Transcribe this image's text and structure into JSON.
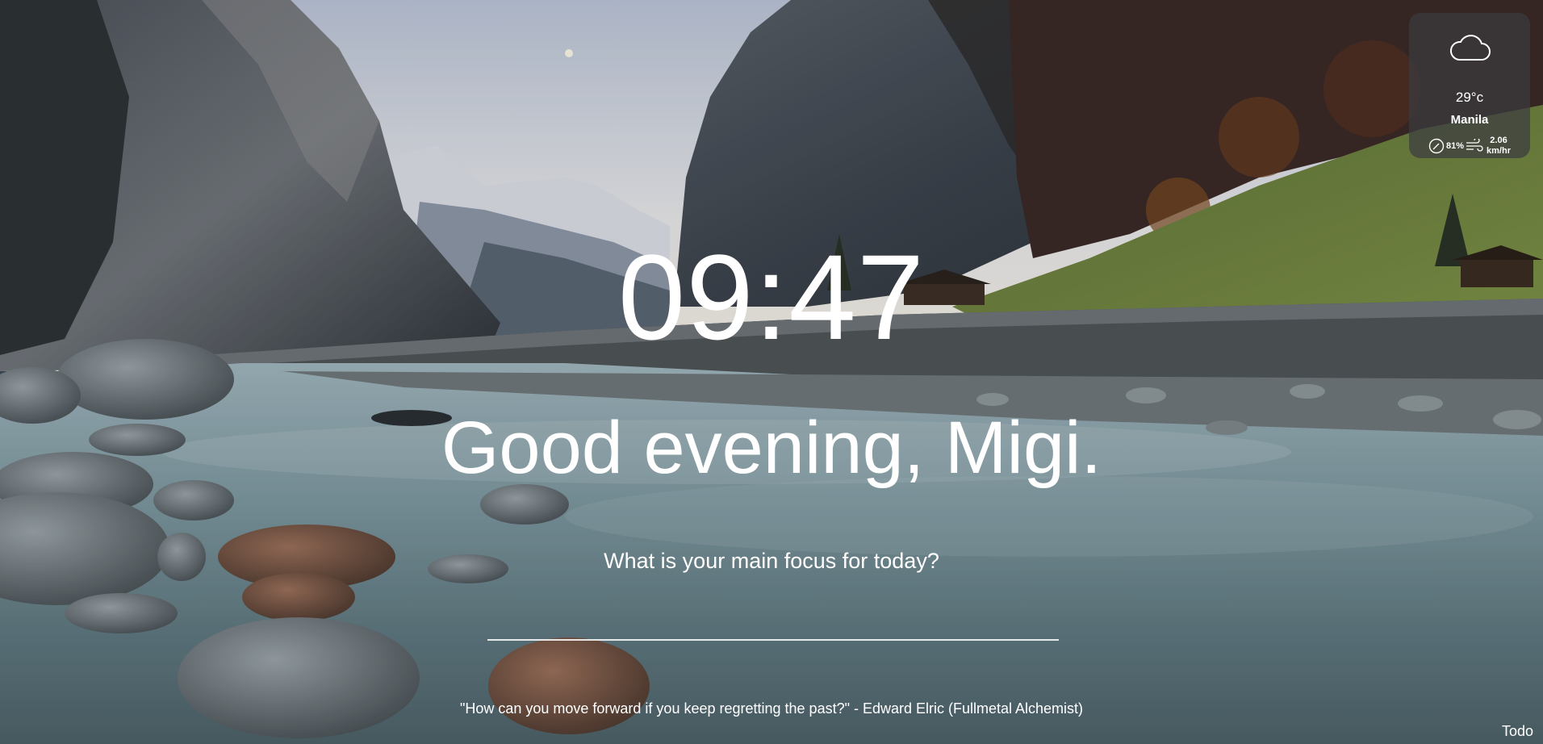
{
  "weather": {
    "icon": "cloud-icon",
    "temperature": "29°c",
    "city": "Manila",
    "humidity": "81%",
    "wind_speed": "2.06",
    "wind_unit": "km/hr"
  },
  "clock": {
    "time": "09:47"
  },
  "greeting": {
    "text": "Good evening, Migi."
  },
  "focus": {
    "question": "What is your main focus for today?",
    "value": ""
  },
  "quote": {
    "text": "\"How can you move forward if you keep regretting the past?\" - Edward Elric (Fullmetal Alchemist)"
  },
  "footer": {
    "todo_label": "Todo"
  }
}
